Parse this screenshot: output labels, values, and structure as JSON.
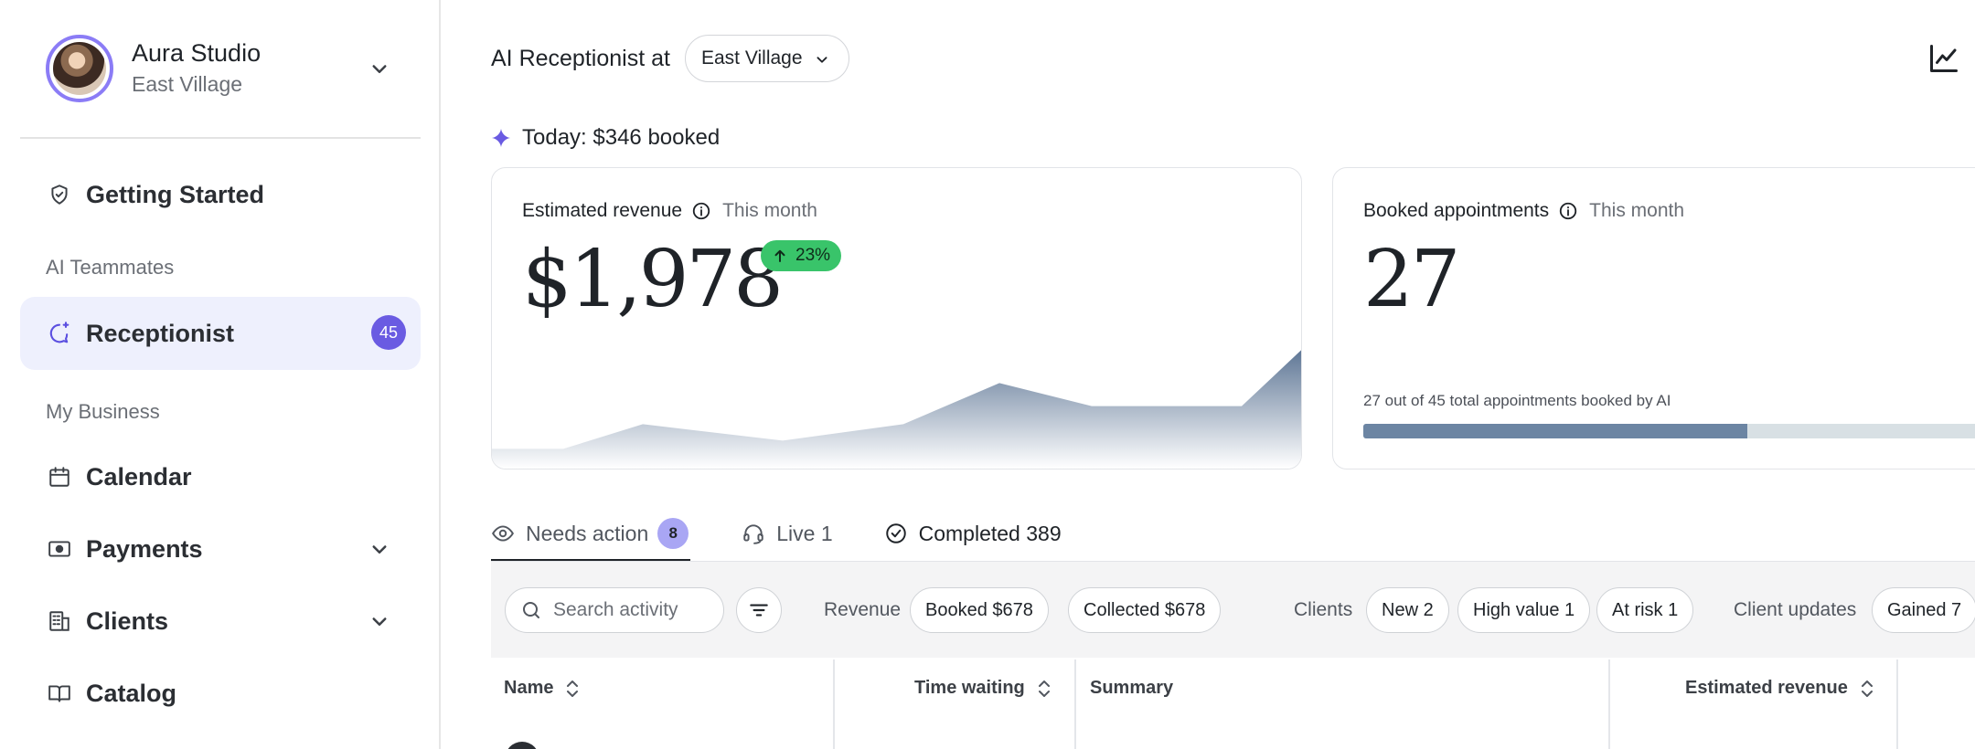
{
  "sidebar": {
    "brand": {
      "name": "Aura Studio",
      "location": "East Village"
    },
    "items": [
      {
        "label": "Getting Started",
        "icon": "shield-check-icon"
      },
      {
        "section": "AI Teammates"
      },
      {
        "label": "Receptionist",
        "icon": "chat-sparkle-icon",
        "badge": "45",
        "active": true
      },
      {
        "section": "My Business"
      },
      {
        "label": "Calendar",
        "icon": "calendar-icon"
      },
      {
        "label": "Payments",
        "icon": "cash-icon",
        "expandable": true
      },
      {
        "label": "Clients",
        "icon": "building-icon",
        "expandable": true
      },
      {
        "label": "Catalog",
        "icon": "book-icon"
      }
    ],
    "labels": {
      "getting_started": "Getting Started",
      "ai_teammates": "AI Teammates",
      "receptionist": "Receptionist",
      "receptionist_badge": "45",
      "my_business": "My Business",
      "calendar": "Calendar",
      "payments": "Payments",
      "clients": "Clients",
      "catalog": "Catalog"
    }
  },
  "header": {
    "title": "AI Receptionist at",
    "location_select": "East Village"
  },
  "today": {
    "text": "Today: $346 booked"
  },
  "cards": {
    "revenue": {
      "title": "Estimated revenue",
      "period": "This month",
      "value": "$1,978",
      "delta": "23%",
      "trend": [
        0.12,
        0.12,
        0.27,
        0.17,
        0.27,
        0.52,
        0.38,
        0.38,
        0.72
      ]
    },
    "appointments": {
      "title": "Booked appointments",
      "period": "This month",
      "value": "27",
      "progress_text": "27 out of 45 total appointments booked by AI",
      "progress_fraction": 0.6
    }
  },
  "tabs": {
    "needs_action": {
      "label": "Needs action",
      "badge": "8"
    },
    "live": {
      "label": "Live 1"
    },
    "completed": {
      "label": "Completed 389"
    }
  },
  "filters": {
    "search_placeholder": "Search activity",
    "revenue_label": "Revenue",
    "booked": "Booked $678",
    "collected": "Collected $678",
    "clients_label": "Clients",
    "new": "New 2",
    "high_value": "High value 1",
    "at_risk": "At risk 1",
    "client_updates_label": "Client updates",
    "gained": "Gained 7"
  },
  "table": {
    "columns": {
      "name": "Name",
      "time_waiting": "Time waiting",
      "summary": "Summary",
      "estimated_revenue": "Estimated revenue"
    }
  },
  "colors": {
    "accent": "#6a5be2",
    "active_bg": "#eef0fd",
    "positive": "#39c46a",
    "chart_fill_top": "#5f7796",
    "progress_fill": "#6c85a3",
    "progress_track": "#d8e0e4"
  }
}
